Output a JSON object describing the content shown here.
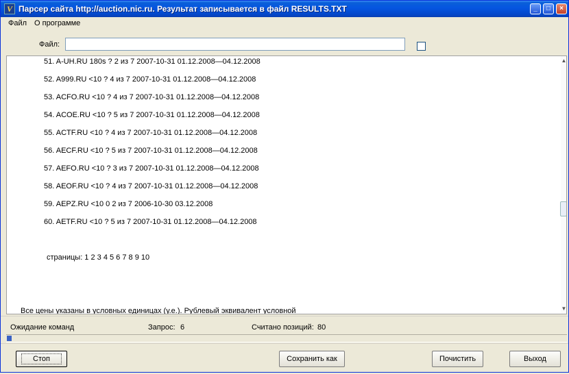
{
  "window": {
    "title": "Парсер сайта http://auction.nic.ru.   Результат записывается в файл RESULTS.TXT"
  },
  "menu": {
    "items": [
      "Файл",
      "О программе"
    ]
  },
  "file_row": {
    "label": "Файл:",
    "value": ""
  },
  "results": {
    "lines": [
      "51. A-UH.RU 180s ? 2 из 7 2007-10-31   01.12.2008—04.12.2008",
      "52. A999.RU <10  ? 4 из 7 2007-10-31   01.12.2008—04.12.2008",
      "53. ACFO.RU <10  ? 4 из 7 2007-10-31   01.12.2008—04.12.2008",
      "54. ACOE.RU <10  ? 5 из 7 2007-10-31   01.12.2008—04.12.2008",
      "55. ACTF.RU <10  ? 4 из 7 2007-10-31   01.12.2008—04.12.2008",
      "56. AECF.RU <10  ? 5 из 7 2007-10-31   01.12.2008—04.12.2008",
      "57. AEFO.RU <10  ? 3 из 7 2007-10-31   01.12.2008—04.12.2008",
      "58. AEOF.RU <10  ? 4 из 7 2007-10-31   01.12.2008—04.12.2008",
      "59. AEPZ.RU  <10  0 2 из 7 2006-10-30   03.12.2008",
      "60. AETF.RU <10  ? 5 из 7 2007-10-31   01.12.2008—04.12.2008"
    ],
    "pages_text": "страницы: 1 2 3 4 5 6 7 8 9 10",
    "footer_note": "Все цены указаны в условных единицах (у.е.). Рублевый эквивалент условной"
  },
  "status": {
    "state": "Ожидание команд",
    "request_label": "Запрос:",
    "request_value": "6",
    "count_label": "Считано позиций:",
    "count_value": "80"
  },
  "progress": {
    "fraction": 0.008
  },
  "buttons": {
    "stop": "Стоп",
    "save_as": "Сохранить как",
    "clear": "Почистить",
    "exit": "Выход"
  },
  "icons": {
    "app": "app-icon",
    "minimize": "minimize-icon",
    "maximize": "maximize-icon",
    "close": "close-icon"
  },
  "colors": {
    "titlebar": "#0555e0",
    "face": "#ece9d8",
    "progress": "#3a62c4"
  }
}
